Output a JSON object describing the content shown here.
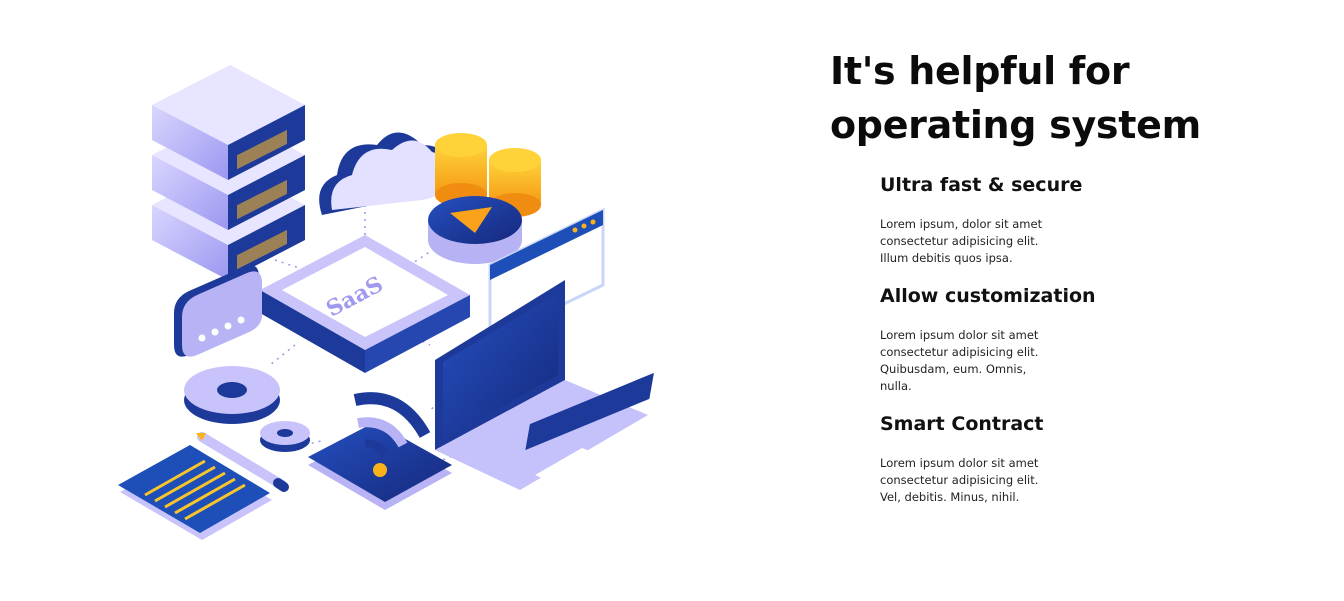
{
  "hero": {
    "title": "It's helpful for operating system",
    "illustration_label": "SaaS"
  },
  "features": [
    {
      "title": "Ultra fast & secure",
      "body": "Lorem ipsum, dolor sit amet consectetur adipisicing elit. Illum debitis quos ipsa."
    },
    {
      "title": "Allow customization",
      "body": "Lorem ipsum dolor sit amet consectetur adipisicing elit. Quibusdam, eum. Omnis, nulla."
    },
    {
      "title": "Smart Contract",
      "body": "Lorem ipsum dolor sit amet consectetur adipisicing elit. Vel, debitis. Minus, nihil."
    }
  ],
  "colors": {
    "accent_dark": "#1f3a9e",
    "accent_light": "#b8b5f5",
    "coin": "#f9b21a",
    "text": "#0b0b0b"
  },
  "icons": [
    "server-icon",
    "cloud-icon",
    "coins-icon",
    "play-icon",
    "browser-window-icon",
    "chat-bubble-icon",
    "gear-icon",
    "laptop-icon",
    "phone-icon",
    "wifi-icon",
    "document-icon",
    "pencil-icon"
  ]
}
